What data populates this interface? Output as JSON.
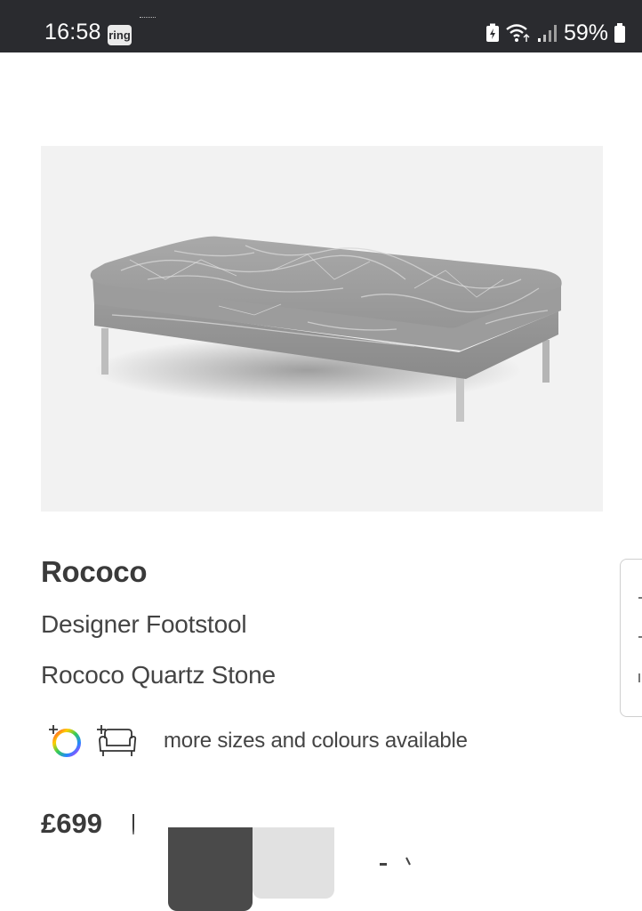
{
  "status_bar": {
    "time": "16:58",
    "ring_label": "ring",
    "battery_percent": "59%",
    "icons": [
      "battery-saver-icon",
      "wifi-icon",
      "signal-icon",
      "battery-icon"
    ]
  },
  "product": {
    "image_alt_icon": "footstool-image",
    "brand": "Rococo",
    "type": "Designer Footstool",
    "colour": "Rococo Quartz Stone",
    "options_text": "more sizes and colours available",
    "price": "£699"
  },
  "colors": {
    "status_bar_bg": "#2a2b2f",
    "text": "#3a3a3a",
    "image_bg": "#f2f2f2"
  }
}
